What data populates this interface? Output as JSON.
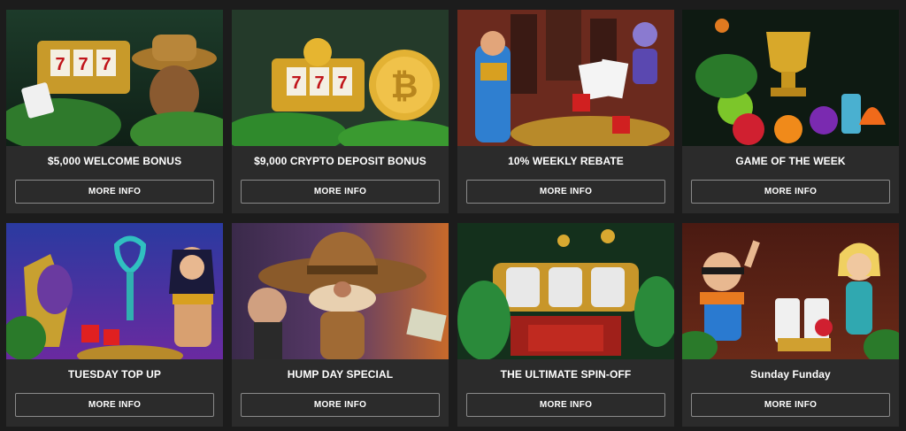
{
  "promotions": [
    {
      "title": "$5,000 WELCOME BONUS",
      "button": "MORE INFO",
      "art": "slot-machine-explorer-image"
    },
    {
      "title": "$9,000 CRYPTO DEPOSIT BONUS",
      "button": "MORE INFO",
      "art": "crypto-slot-machine-image"
    },
    {
      "title": "10% WEEKLY REBATE",
      "button": "MORE INFO",
      "art": "superhero-casino-image"
    },
    {
      "title": "GAME OF THE WEEK",
      "button": "MORE INFO",
      "art": "trophy-fruit-image"
    },
    {
      "title": "TUESDAY TOP UP",
      "button": "MORE INFO",
      "art": "egyptian-queen-image"
    },
    {
      "title": "HUMP DAY SPECIAL",
      "button": "MORE INFO",
      "art": "cowboy-hat-image"
    },
    {
      "title": "THE ULTIMATE SPIN-OFF",
      "button": "MORE INFO",
      "art": "gold-slot-reels-image"
    },
    {
      "title": "Sunday Funday",
      "button": "MORE INFO",
      "art": "party-characters-image"
    }
  ],
  "colors": {
    "page_background": "#1c1c1c",
    "card_background": "#2b2b2b",
    "button_border": "#8a8a8a",
    "text": "#ffffff"
  }
}
